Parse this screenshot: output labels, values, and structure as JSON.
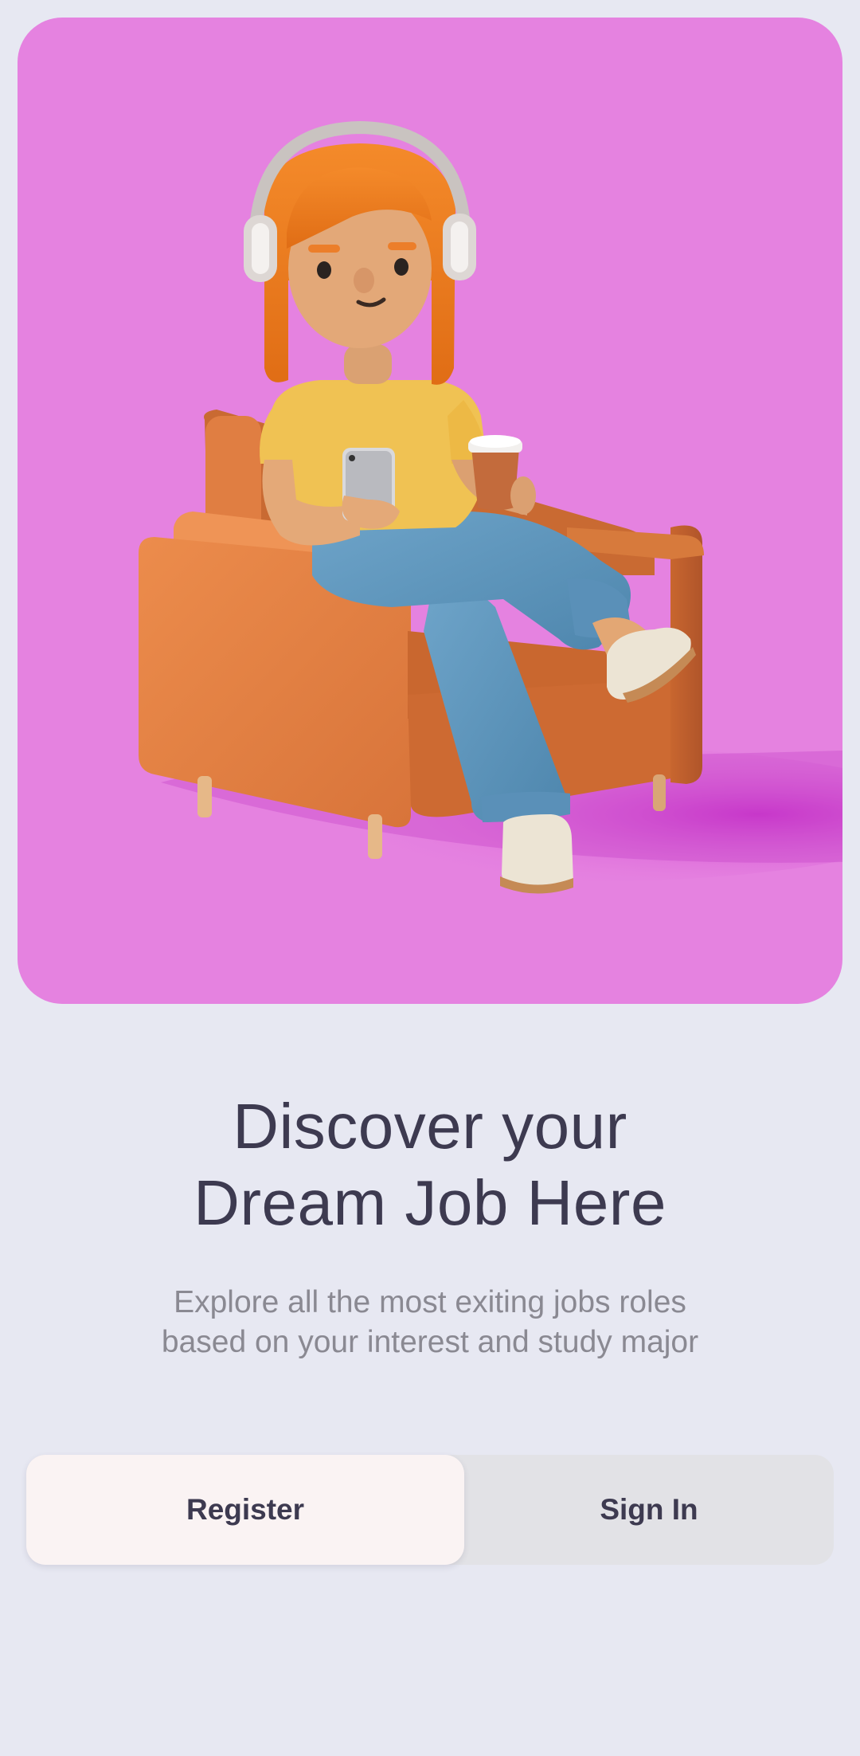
{
  "hero": {
    "background": "#e582e0",
    "illustration": "woman-with-headphones-in-armchair"
  },
  "headline": {
    "line1": "Discover your",
    "line2": "Dream Job Here"
  },
  "subtitle": {
    "line1": "Explore all the most exiting jobs roles",
    "line2": "based on your interest and study major"
  },
  "auth": {
    "register_label": "Register",
    "signin_label": "Sign In",
    "active": "Register"
  },
  "colors": {
    "page_bg": "#e7e8f2",
    "text_primary": "#3d3a50",
    "text_secondary": "#8a8992",
    "active_tab": "#faf3f3",
    "segment_bg": "#e2e2e6"
  }
}
